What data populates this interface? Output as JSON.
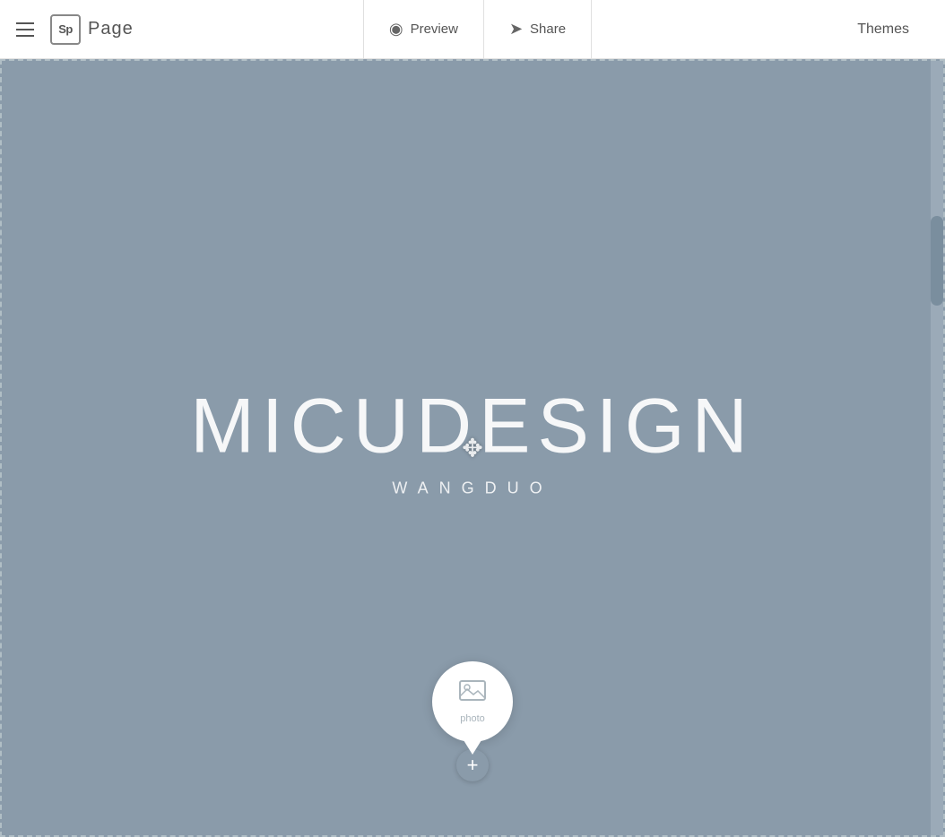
{
  "header": {
    "logo_text": "Sp",
    "page_label": "Page",
    "preview_label": "Preview",
    "share_label": "Share",
    "themes_label": "Themes"
  },
  "canvas": {
    "bg_color": "#8a9baa",
    "main_title": "MICUDESIGN",
    "sub_title": "WANGDUO",
    "photo_label": "photo",
    "add_label": "+"
  }
}
